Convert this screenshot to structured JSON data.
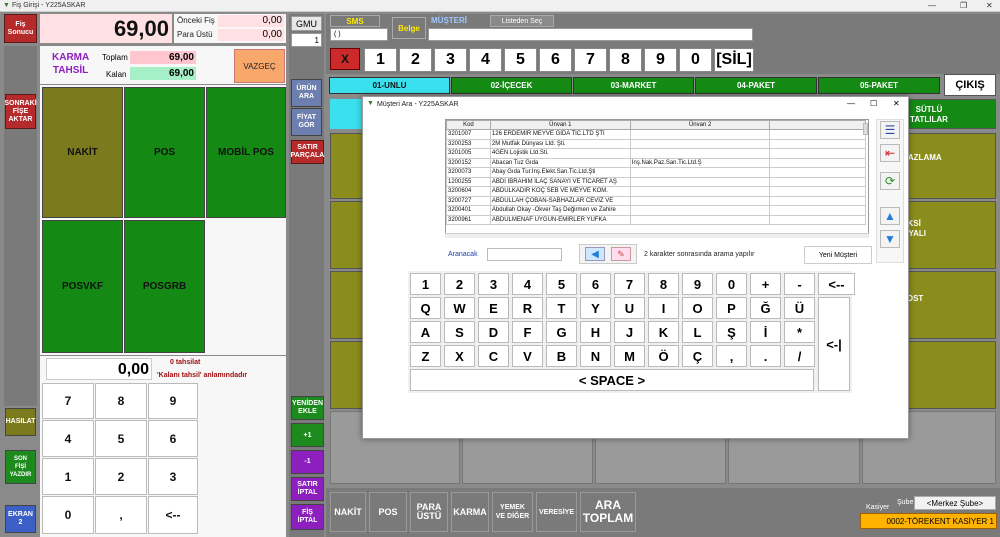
{
  "window": {
    "title": "Fiş Girişi - Y225ASKAR"
  },
  "left_panel": {
    "fis_sonucu": "Fiş\nSonucu",
    "total_display": "69,00",
    "onceki_fis_label": "Önceki Fiş",
    "onceki_fis_value": "0,00",
    "para_ustu_label": "Para Üstü",
    "para_ustu_value": "0,00",
    "karma_tahsil": "KARMA\nTAHSİL",
    "toplam_label": "Toplam",
    "toplam_value": "69,00",
    "kalan_label": "Kalan",
    "kalan_value": "69,00",
    "vazgec": "VAZGEÇ",
    "sonraki_fis_aktar": "SONRAKİ\nFİŞE\nAKTAR",
    "payments": [
      "NAKİT",
      "POS",
      "MOBİL POS",
      "POSVKF",
      "POSGRB"
    ],
    "amount_display": "0,00",
    "tahsilat_note": "0 tahsilat",
    "kalani_tahsil_note": "'Kalanı tahsil' anlamındadır",
    "numpad": [
      "7",
      "8",
      "9",
      "4",
      "5",
      "6",
      "1",
      "2",
      "3",
      "0",
      ",",
      "<--"
    ],
    "hasilat": "HASILAT",
    "son_fisi_yazdir": "SON\nFİŞİ\nYAZDIR",
    "ekran2": "EKRAN\n2"
  },
  "center_strip": {
    "gmu": "GMU",
    "gmu_value": "1",
    "urun_ara": "ÜRÜN\nARA",
    "fiyat_gor": "FİYAT\nGÖR",
    "satir_parcala": "SATIR\nPARÇALA",
    "yeniden_ekle": "YENİDEN\nEKLE",
    "plus1": "+1",
    "minus1": "-1",
    "satir_iptal": "SATIR\nİPTAL",
    "fis_iptal": "FİŞ\nİPTAL"
  },
  "top_bar": {
    "sms": "SMS",
    "sms_field": "( )",
    "belge": "Belge",
    "musteri": "MÜŞTERİ",
    "listeden_sec": "Listeden Seç",
    "x_btn": "X",
    "digits": [
      "1",
      "2",
      "3",
      "4",
      "5",
      "6",
      "7",
      "8",
      "9",
      "0"
    ],
    "sil": "[SİL]"
  },
  "category_tabs": [
    "01-UNLU",
    "02-İÇECEK",
    "03-MARKET",
    "04-PAKET",
    "05-PAKET"
  ],
  "cikis": "ÇIKIŞ",
  "products": [
    {
      "name": "SÜTLÜ\nTATLILAR"
    },
    {
      "name": "EKMEK BAZLAMA\n400 GR\n5,00 TL"
    },
    {
      "name": "EKMEK EKSİ\nMADE MAYALI\nKG\n20,00 TL"
    },
    {
      "name": "EKMEK TOST\nEKMEĞİ\n25,00 TL"
    }
  ],
  "bottom_bar": {
    "buttons": [
      "NAKİT",
      "POS",
      "PARA\nÜSTÜ",
      "KARMA",
      "YEMEK\nVE DİĞER",
      "VERESİYE",
      "ARA\nTOPLAM"
    ],
    "kasiyer_label": "Kasiyer",
    "sube_label": "Şube",
    "sube_value": "<Merkez Şube>",
    "kasiyer_value": "0002-TÖREKENT KASİYER 1"
  },
  "dialog": {
    "title": "Müşteri Ara - Y225ASKAR",
    "columns": [
      "Kod",
      "Ünvan 1",
      "Ünvan 2"
    ],
    "rows": [
      [
        "3201007",
        "126 ERDEMİR MEYVE GIDA TİC.LTD ŞTİ",
        ""
      ],
      [
        "3200253",
        "2M Mutfak Dünyası Ltd. Şti.",
        ""
      ],
      [
        "3201005",
        "4GEN Lojistik Ltd.Sti.",
        ""
      ],
      [
        "3200152",
        "Abacan Tuz Gıda",
        "İnş.Nak.Paz.San.Tic.Ltd.Ş"
      ],
      [
        "3200073",
        "Abay Gıda Tur.İnş.Elekt.San.Tic.Ltd.Şti",
        ""
      ],
      [
        "1200255",
        "ABDİ İBRAHİM İLAÇ SANAYİ VE TİCARET AŞ",
        ""
      ],
      [
        "3200604",
        "ABDULKADİR KOÇ SEB VE MEYVE KOM.",
        ""
      ],
      [
        "3200727",
        "ABDULLAH ÇOBAN-SABHAZLAR CEVİZ VE",
        ""
      ],
      [
        "3200401",
        "Abdullah Okay -Okver Taş Değirmen ve Zahire",
        ""
      ],
      [
        "3200961",
        "ABDULMENAF UYGUN-EMİRLER YUFKA",
        ""
      ]
    ],
    "aranacak_label": "Aranacak",
    "hint": "2 karakter sonrasında arama yapılır",
    "yeni_musteri": "Yeni Müşteri",
    "kb_row1": [
      "1",
      "2",
      "3",
      "4",
      "5",
      "6",
      "7",
      "8",
      "9",
      "0",
      "+",
      "-",
      "<--"
    ],
    "kb_row2": [
      "Q",
      "W",
      "E",
      "R",
      "T",
      "Y",
      "U",
      "I",
      "O",
      "P",
      "Ğ",
      "Ü"
    ],
    "kb_row3": [
      "A",
      "S",
      "D",
      "F",
      "G",
      "H",
      "J",
      "K",
      "L",
      "Ş",
      "İ",
      "*"
    ],
    "kb_row4": [
      "Z",
      "X",
      "C",
      "V",
      "B",
      "N",
      "M",
      "Ö",
      "Ç",
      ",",
      ".",
      "/"
    ],
    "enter": "<-|",
    "space": "< SPACE >"
  }
}
